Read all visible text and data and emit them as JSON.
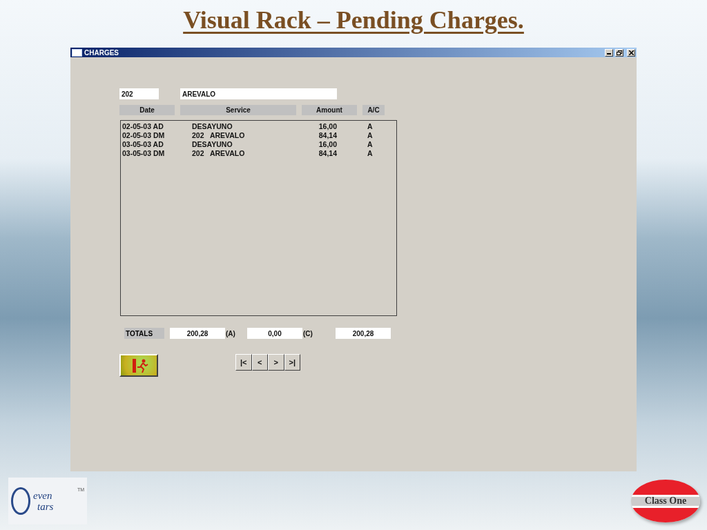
{
  "slide_title": "Visual Rack – Pending Charges.",
  "window": {
    "title": "CHARGES"
  },
  "room_field": {
    "value": "202"
  },
  "name_field": {
    "value": "AREVALO"
  },
  "columns": [
    "Date",
    "Service",
    "Amount",
    "A/C"
  ],
  "rows": [
    {
      "date": "02-05-03 AD",
      "service": "DESAYUNO",
      "amount": "16,00",
      "ac": "A"
    },
    {
      "date": "02-05-03 DM",
      "service": "202   AREVALO",
      "amount": "84,14",
      "ac": "A"
    },
    {
      "date": "03-05-03 AD",
      "service": "DESAYUNO",
      "amount": "16,00",
      "ac": "A"
    },
    {
      "date": "03-05-03 DM",
      "service": "202   AREVALO",
      "amount": "84,14",
      "ac": "A"
    }
  ],
  "totals": {
    "label": "TOTALS",
    "a_value": "200,28",
    "a_label": "(A)",
    "c_value": "0,00",
    "c_label": "(C)",
    "total_value": "200,28"
  },
  "nav_buttons": [
    "|<",
    "<",
    ">",
    ">|"
  ],
  "logos": {
    "left_line_1": "even",
    "left_line_2": "tars",
    "left_mark": "TM",
    "right": "Class One"
  }
}
